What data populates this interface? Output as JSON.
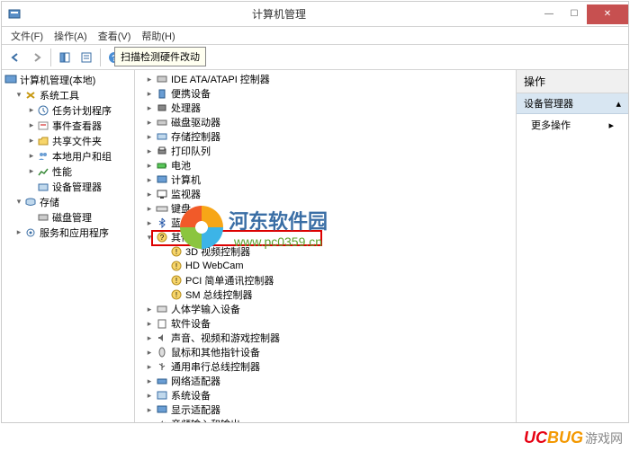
{
  "window": {
    "title": "计算机管理",
    "min": "—",
    "max": "☐",
    "close": "✕"
  },
  "menu": {
    "file": "文件(F)",
    "action": "操作(A)",
    "view": "查看(V)",
    "help": "帮助(H)"
  },
  "tooltip": "扫描检测硬件改动",
  "left_tree": {
    "root": "计算机管理(本地)",
    "sys_tools": "系统工具",
    "task_sched": "任务计划程序",
    "event_viewer": "事件查看器",
    "shared_folders": "共享文件夹",
    "local_users": "本地用户和组",
    "performance": "性能",
    "device_mgr": "设备管理器",
    "storage": "存储",
    "disk_mgmt": "磁盘管理",
    "services_apps": "服务和应用程序"
  },
  "device_tree": {
    "ide": "IDE ATA/ATAPI 控制器",
    "portable": "便携设备",
    "processor": "处理器",
    "disk_drive": "磁盘驱动器",
    "storage_ctrl": "存储控制器",
    "print_queue": "打印队列",
    "battery": "电池",
    "computer": "计算机",
    "monitor": "监视器",
    "keyboard": "键盘",
    "bluetooth": "蓝牙",
    "other": "其他设备",
    "other_3d": "3D 视频控制器",
    "other_webcam": "HD WebCam",
    "other_pci": "PCI 简单通讯控制器",
    "other_sm": "SM 总线控制器",
    "hid": "人体学输入设备",
    "software": "软件设备",
    "sound": "声音、视频和游戏控制器",
    "mouse": "鼠标和其他指针设备",
    "usb": "通用串行总线控制器",
    "network": "网络适配器",
    "system": "系统设备",
    "display": "显示适配器",
    "audio_io": "音频输入和输出"
  },
  "right": {
    "header": "操作",
    "subheader": "设备管理器",
    "more": "更多操作"
  },
  "watermark": {
    "text1": "河东软件园",
    "text2": "www.pc0359.cn"
  },
  "footer": {
    "u": "UC",
    "bug": "BUG",
    "tail": "游戏网"
  }
}
